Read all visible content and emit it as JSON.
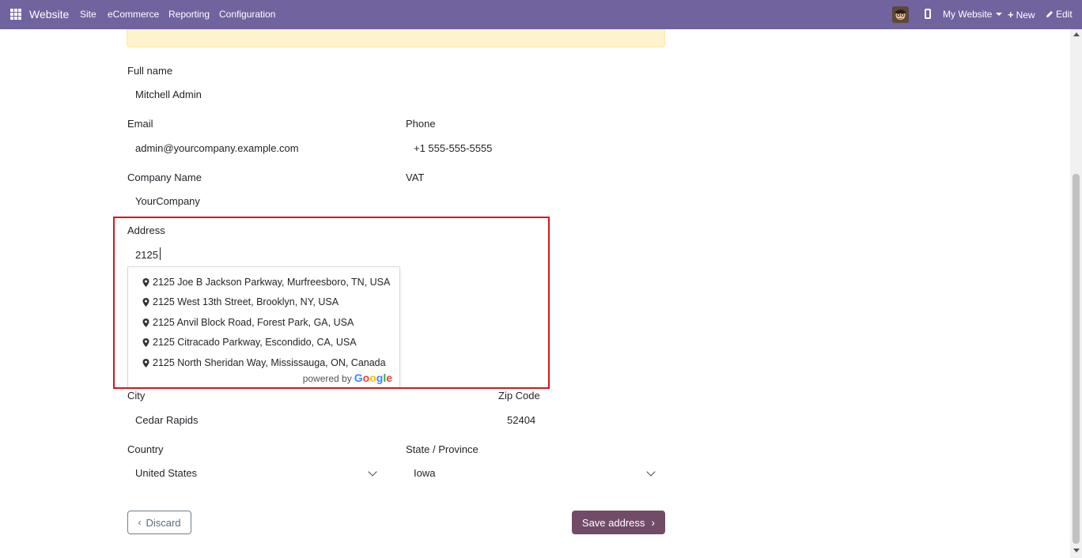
{
  "navbar": {
    "brand": "Website",
    "menus": [
      "Site",
      "eCommerce",
      "Reporting",
      "Configuration"
    ],
    "website_selector": "My Website",
    "new_label": "New",
    "edit_label": "Edit",
    "bg_color": "#71639e"
  },
  "form": {
    "full_name": {
      "label": "Full name",
      "value": "Mitchell Admin"
    },
    "email": {
      "label": "Email",
      "value": "admin@yourcompany.example.com"
    },
    "phone": {
      "label": "Phone",
      "value": "+1 555-555-5555"
    },
    "company": {
      "label": "Company Name",
      "value": "YourCompany"
    },
    "vat": {
      "label": "VAT",
      "value": ""
    },
    "address": {
      "label": "Address",
      "value": "2125"
    },
    "city": {
      "label": "City",
      "value": "Cedar Rapids"
    },
    "zip": {
      "label": "Zip Code",
      "value": "52404"
    },
    "country": {
      "label": "Country",
      "value": "United States"
    },
    "state": {
      "label": "State / Province",
      "value": "Iowa"
    }
  },
  "suggestions": [
    "2125 Joe B Jackson Parkway, Murfreesboro, TN, USA",
    "2125 West 13th Street, Brooklyn, NY, USA",
    "2125 Anvil Block Road, Forest Park, GA, USA",
    "2125 Citracado Parkway, Escondido, CA, USA",
    "2125 North Sheridan Way, Mississauga, ON, Canada"
  ],
  "powered_by": "powered by",
  "google": [
    "G",
    "o",
    "o",
    "g",
    "l",
    "e"
  ],
  "buttons": {
    "discard": "Discard",
    "save": "Save address"
  },
  "colors": {
    "highlight": "#d9141e",
    "save_button": "#714b67"
  }
}
